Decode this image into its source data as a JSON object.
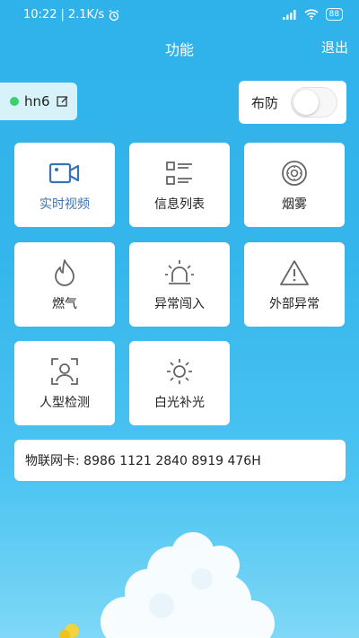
{
  "status_bar": {
    "time": "10:22",
    "network_speed": "2.1K/s",
    "battery": "88"
  },
  "header": {
    "title": "功能",
    "logout_label": "退出"
  },
  "device": {
    "name": "hn6",
    "online": true
  },
  "arm": {
    "label": "布防",
    "enabled": false
  },
  "functions": [
    {
      "label": "实时视频",
      "icon": "video-camera-icon",
      "highlight": true
    },
    {
      "label": "信息列表",
      "icon": "list-icon"
    },
    {
      "label": "烟雾",
      "icon": "smoke-detector-icon"
    },
    {
      "label": "燃气",
      "icon": "flame-icon"
    },
    {
      "label": "异常闯入",
      "icon": "alarm-light-icon"
    },
    {
      "label": "外部异常",
      "icon": "warning-icon"
    },
    {
      "label": "人型检测",
      "icon": "person-detect-icon"
    },
    {
      "label": "白光补光",
      "icon": "sun-icon"
    }
  ],
  "iot_card": {
    "text": "物联网卡: 8986 1121 2840 8919 476H"
  },
  "colors": {
    "background": "#2fb2ea",
    "accent": "#3a73b5",
    "online": "#3bd16f"
  }
}
